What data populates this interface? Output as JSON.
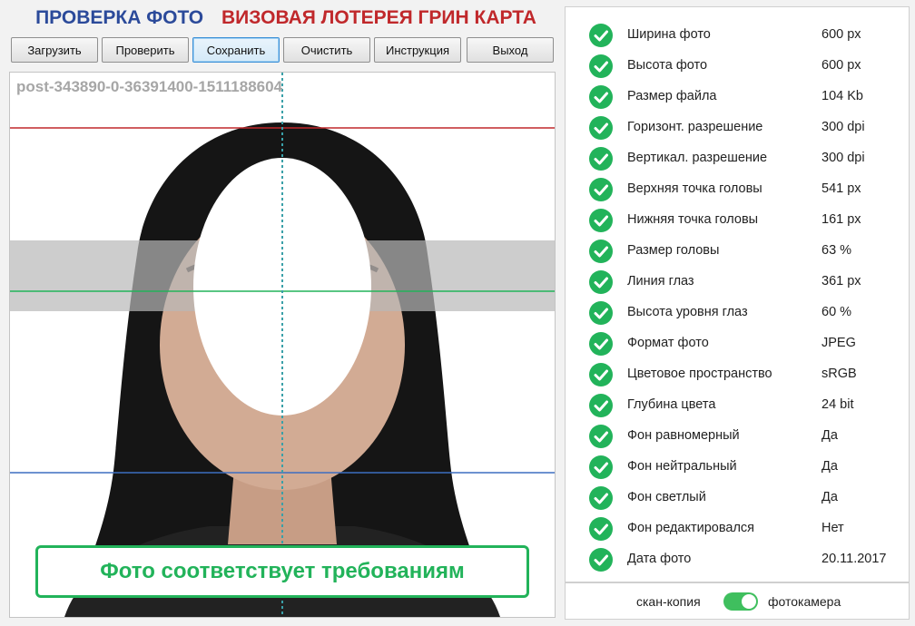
{
  "header": {
    "title_left": "ПРОВЕРКА ФОТО",
    "title_right": "ВИЗОВАЯ ЛОТЕРЕЯ ГРИН КАРТА"
  },
  "toolbar": {
    "buttons": [
      {
        "label": "Загрузить"
      },
      {
        "label": "Проверить"
      },
      {
        "label": "Сохранить",
        "active": true
      },
      {
        "label": "Очистить"
      },
      {
        "label": "Инструкция"
      },
      {
        "label": "Выход"
      }
    ]
  },
  "photo": {
    "filename": "post-343890-0-36391400-1511188604",
    "status": "Фото соответствует требованиям"
  },
  "results": [
    {
      "label": "Ширина фото",
      "value": "600 px"
    },
    {
      "label": "Высота фото",
      "value": "600 px"
    },
    {
      "label": "Размер файла",
      "value": "104 Kb"
    },
    {
      "label": "Горизонт. разрешение",
      "value": "300 dpi"
    },
    {
      "label": "Вертикал. разрешение",
      "value": "300 dpi"
    },
    {
      "label": "Верхняя точка головы",
      "value": "541 px"
    },
    {
      "label": "Нижняя точка головы",
      "value": "161 px"
    },
    {
      "label": "Размер головы",
      "value": "63 %"
    },
    {
      "label": "Линия глаз",
      "value": "361 px"
    },
    {
      "label": "Высота уровня глаз",
      "value": "60 %"
    },
    {
      "label": "Формат фото",
      "value": "JPEG"
    },
    {
      "label": "Цветовое пространство",
      "value": "sRGB"
    },
    {
      "label": "Глубина цвета",
      "value": "24 bit"
    },
    {
      "label": "Фон равномерный",
      "value": "Да"
    },
    {
      "label": "Фон нейтральный",
      "value": "Да"
    },
    {
      "label": "Фон светлый",
      "value": "Да"
    },
    {
      "label": "Фон редактировался",
      "value": "Нет"
    },
    {
      "label": "Дата фото",
      "value": "20.11.2017"
    }
  ],
  "footer": {
    "left_label": "скан-копия",
    "right_label": "фотокамера",
    "toggle_on": true
  },
  "colors": {
    "title_blue": "#2b4a9a",
    "title_red": "#c0282b",
    "ok_green": "#22b35a",
    "top_line": "#c0282b",
    "eye_line": "#22b35a",
    "chin_line": "#3d6ec0",
    "center_line": "#3aa0a8"
  }
}
